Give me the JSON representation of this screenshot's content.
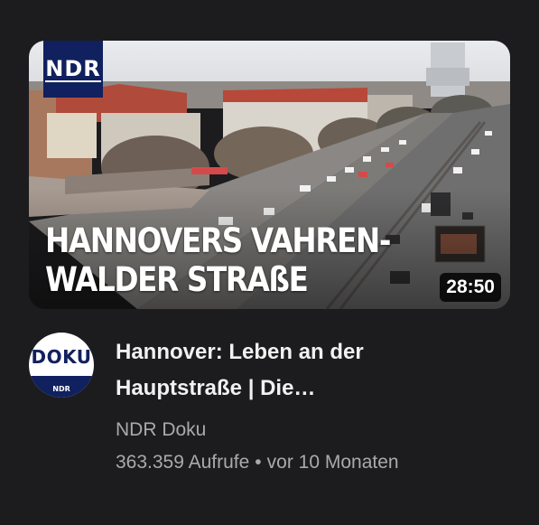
{
  "thumbnail": {
    "logo_text": "NDR",
    "headline_line1": "HANNOVERS VAHREN-",
    "headline_line2": "WALDER STRAßE",
    "duration": "28:50"
  },
  "channel_avatar": {
    "top_text": "DOKU",
    "bottom_text": "NDR"
  },
  "video": {
    "title_line1": "Hannover: Leben an der",
    "title_line2": "Hauptstraße | Die…",
    "channel_name": "NDR Doku",
    "views": "363.359 Aufrufe",
    "separator": "•",
    "age": "vor 10 Monaten"
  },
  "colors": {
    "background": "#1c1c1e",
    "ndr_blue": "#11205e",
    "title_text": "#f1f1f1",
    "secondary_text": "#aaaaaa"
  }
}
